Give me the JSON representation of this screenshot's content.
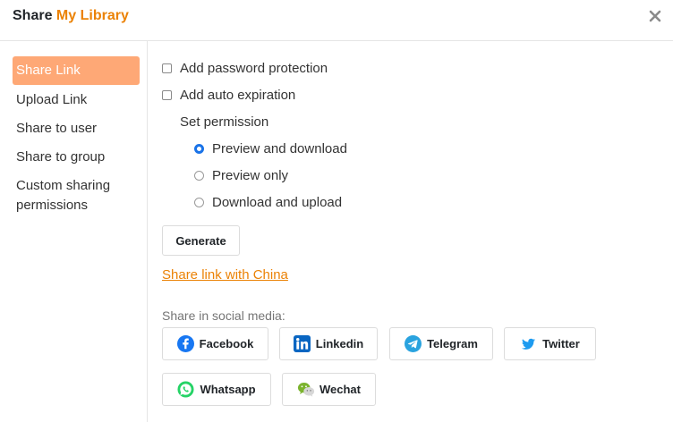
{
  "dialog": {
    "title_prefix": "Share",
    "library_name": "My Library",
    "close_icon": "close-icon"
  },
  "sidebar": {
    "items": [
      {
        "label": "Share Link",
        "active": true
      },
      {
        "label": "Upload Link"
      },
      {
        "label": "Share to user"
      },
      {
        "label": "Share to group"
      },
      {
        "label": "Custom sharing"
      },
      {
        "label": "permissions"
      }
    ]
  },
  "options": {
    "password_label": "Add password protection",
    "expiration_label": "Add auto expiration",
    "permission_heading": "Set permission",
    "permissions": [
      {
        "label": "Preview and download",
        "selected": true
      },
      {
        "label": "Preview only",
        "selected": false
      },
      {
        "label": "Download and upload",
        "selected": false
      }
    ]
  },
  "actions": {
    "generate_label": "Generate",
    "china_link": "Share link with China",
    "social_heading": "Share in social media:",
    "social": [
      {
        "label": "Facebook",
        "icon": "facebook-icon",
        "color": "#1877f2"
      },
      {
        "label": "Linkedin",
        "icon": "linkedin-icon",
        "color": "#0a66c2"
      },
      {
        "label": "Telegram",
        "icon": "telegram-icon",
        "color": "#2aa3df"
      },
      {
        "label": "Twitter",
        "icon": "twitter-icon",
        "color": "#1d9bf0"
      },
      {
        "label": "Whatsapp",
        "icon": "whatsapp-icon",
        "color": "#25d366"
      },
      {
        "label": "Wechat",
        "icon": "wechat-icon",
        "color": "#7bb32e"
      }
    ]
  },
  "colors": {
    "accent": "#eb8205",
    "active_nav": "#fea876",
    "radio_checked": "#1a73e8"
  }
}
